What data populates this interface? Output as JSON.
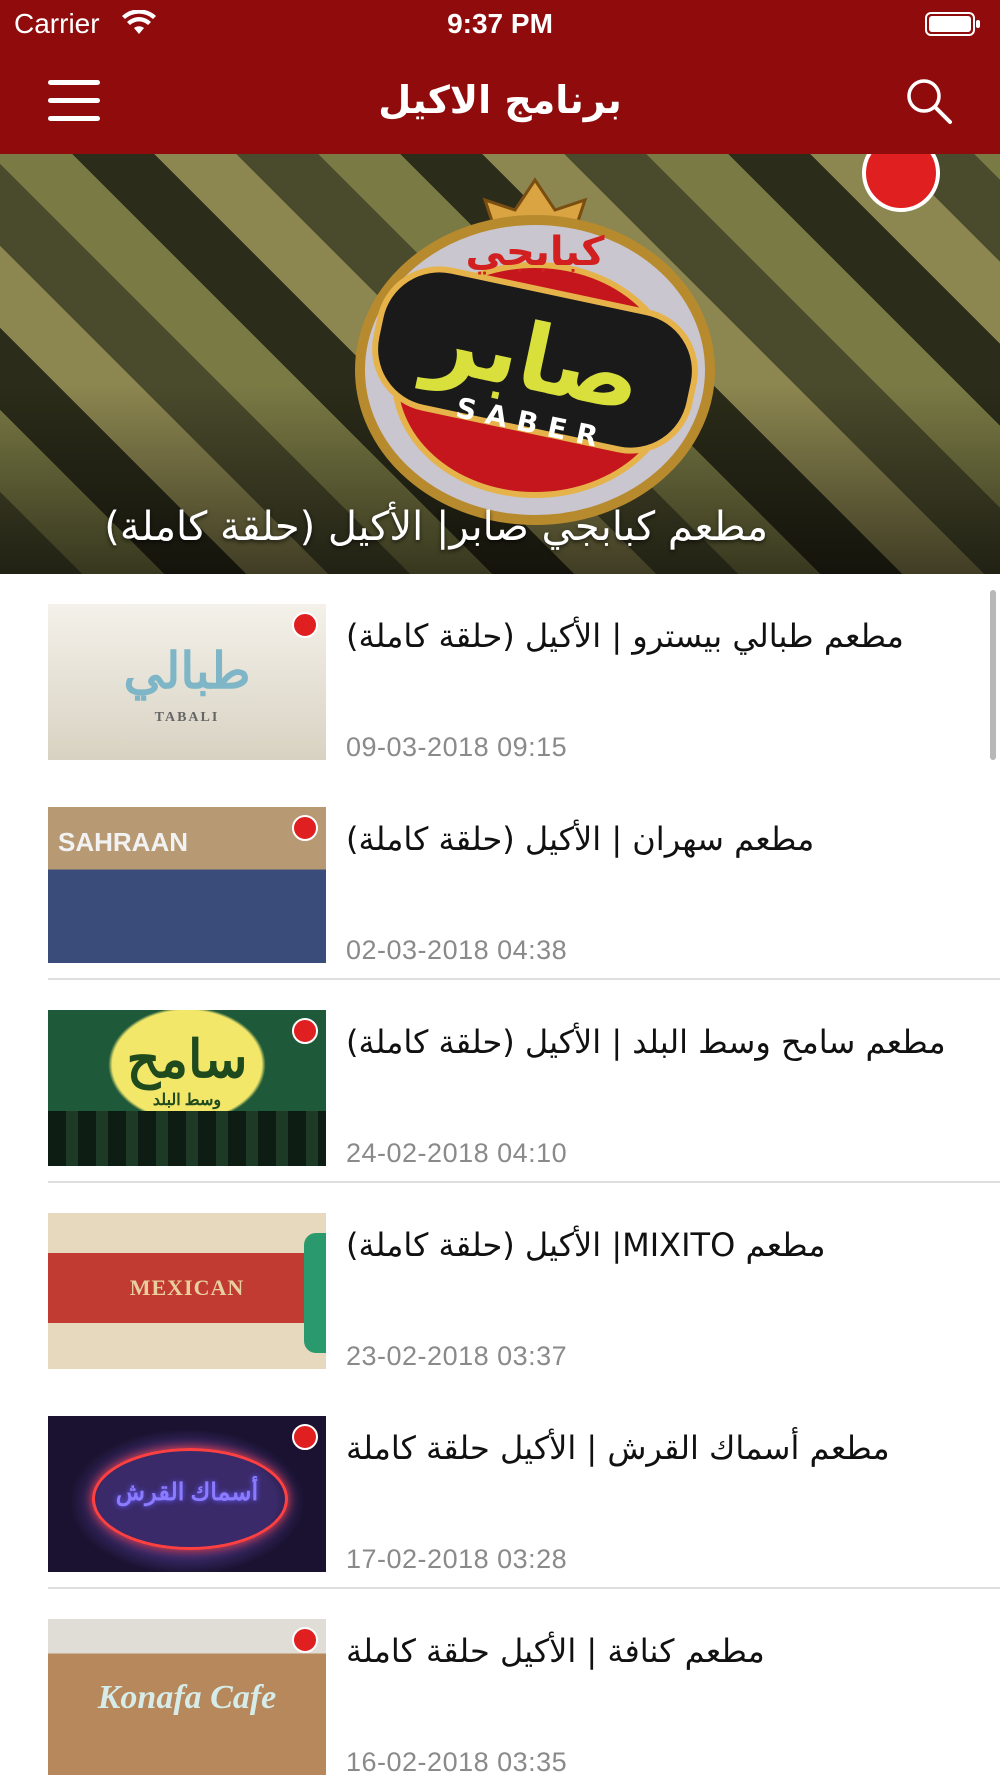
{
  "status_bar": {
    "carrier": "Carrier",
    "time": "9:37 PM",
    "wifi_icon": "wifi-icon",
    "battery_icon": "battery-full-icon"
  },
  "nav": {
    "title": "برنامج الاكيل",
    "menu_icon": "hamburger-menu-icon",
    "search_icon": "search-icon",
    "bar_color": "#900c0c"
  },
  "hero": {
    "caption": "مطعم كبابجي صابر| الأكيل (حلقة كاملة)",
    "logo_text_ar_top": "كبابجي",
    "logo_text_ar": "صابر",
    "logo_text_en": "SABER"
  },
  "items": [
    {
      "title": "مطعم طبالي بيسترو | الأكيل (حلقة كاملة)",
      "date": "09-03-2018 09:15",
      "thumb_text": "طبالي",
      "thumb_sub": "TABALI"
    },
    {
      "title": "مطعم سهران | الأكيل (حلقة كاملة)",
      "date": "02-03-2018 04:38",
      "thumb_text": "SAHRAAN"
    },
    {
      "title": "مطعم سامح وسط البلد | الأكيل (حلقة كاملة)",
      "date": "24-02-2018 04:10",
      "thumb_text": "سامح",
      "thumb_sub": "وسط البلد"
    },
    {
      "title": "مطعم MIXITO| الأكيل (حلقة كاملة)",
      "date": "23-02-2018 03:37",
      "thumb_text": "MEXICAN"
    },
    {
      "title": "مطعم أسماك القرش | الأكيل حلقة كاملة",
      "date": "17-02-2018 03:28",
      "thumb_text": "أسماك القرش"
    },
    {
      "title": "مطعم كنافة | الأكيل حلقة كاملة",
      "date": "16-02-2018 03:35",
      "thumb_text": "Konafa Cafe"
    }
  ]
}
